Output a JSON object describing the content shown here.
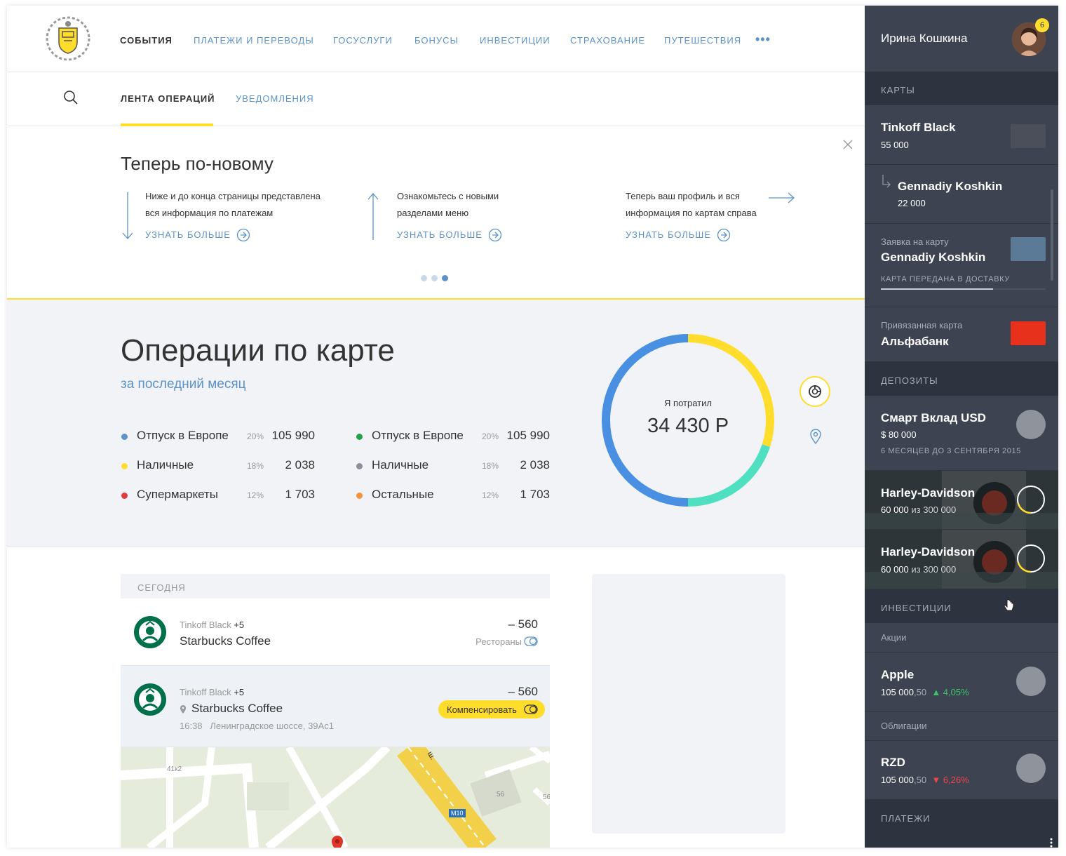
{
  "nav": {
    "items": [
      "События",
      "Платежи и переводы",
      "Госуслуги",
      "Бонусы",
      "Инвестиции",
      "Страхование",
      "Путешествия"
    ],
    "more": "•••"
  },
  "subnav": {
    "tab_feed": "Лента операций",
    "tab_notifications": "Уведомления"
  },
  "promo": {
    "title": "Теперь по-новому",
    "tips": [
      {
        "line1": "Ниже и до конца страницы представлена",
        "line2": "вся информация по платежам",
        "link": "Узнать больше"
      },
      {
        "line1": "Ознакомьтесь  с новыми",
        "line2": "разделами меню",
        "link": "Узнать больше"
      },
      {
        "line1": "Теперь ваш профиль и вся",
        "line2": "информация по картам справа",
        "link": "Узнать больше"
      }
    ],
    "active_slide": 3
  },
  "ops": {
    "title": "Операции по карте",
    "subtitle": "за последний месяц",
    "legend_left": [
      {
        "name": "Отпуск в Европе",
        "pct": "20%",
        "value": "105 990",
        "color": "#5b93c7"
      },
      {
        "name": "Наличные",
        "pct": "18%",
        "value": "2 038",
        "color": "#ffdd2d"
      },
      {
        "name": "Супермаркеты",
        "pct": "12%",
        "value": "1 703",
        "color": "#e03c3c"
      }
    ],
    "legend_right": [
      {
        "name": "Отпуск в Европе",
        "pct": "20%",
        "value": "105 990",
        "color": "#22a14d"
      },
      {
        "name": "Наличные",
        "pct": "18%",
        "value": "2 038",
        "color": "#8a8f99"
      },
      {
        "name": "Остальные",
        "pct": "12%",
        "value": "1 703",
        "color": "#f5943a"
      }
    ],
    "donut_caption": "Я потратил",
    "donut_value": "34 430 Р"
  },
  "chart_data": {
    "type": "pie",
    "title": "",
    "segments": [
      {
        "color": "#ffdd2d",
        "fraction": 0.3
      },
      {
        "color": "#4fe0c2",
        "fraction": 0.2
      },
      {
        "color": "#4a90e2",
        "fraction": 0.5
      }
    ]
  },
  "feed": {
    "day": "Сегодня",
    "rows": [
      {
        "card": "Tinkoff Black",
        "bonus": "+5",
        "shop": "Starbucks Coffee",
        "amount": "– 560",
        "category": "Рестораны"
      },
      {
        "card": "Tinkoff Black",
        "bonus": "+5",
        "shop": "Starbucks Coffee",
        "amount": "– 560",
        "compensate": "Компенсировать",
        "time": "16:38",
        "address": "Ленинградское шоссе, 39Ас1"
      }
    ],
    "map_labels": [
      "41к2",
      "56",
      "56",
      "ш.",
      "М10"
    ]
  },
  "side": {
    "user_name": "Ирина Кошкина",
    "badge": "6",
    "sections": {
      "cards": "Карты",
      "deposits": "Депозиты",
      "investments": "Инвестиции",
      "payments": "Платежи"
    },
    "cards": [
      {
        "title": "Tinkoff Black",
        "sub": "55 000",
        "chip": "#4a4f5a"
      },
      {
        "title": "Gennadiy Koshkin",
        "sub": "22 000"
      },
      {
        "label": "Заявка на карту",
        "title": "Gennadiy Koshkin",
        "status": "Карта передана в доставку",
        "chip": "#5a7a95",
        "progress": 0.68
      },
      {
        "label": "Привязанная карта",
        "title": "Альфабанк",
        "chip": "#e8311c"
      }
    ],
    "deposits": [
      {
        "title": "Смарт Вклад USD",
        "sub": "$ 80 000",
        "note": "6 месяцев до 3 сентября 2015"
      },
      {
        "title": "Harley-Davidson",
        "sub": "60 000",
        "of": "из 300 000",
        "progress": 0.2
      },
      {
        "title": "Harley-Davidson",
        "sub": "60 000",
        "of": "из 300 000",
        "progress": 0.2
      }
    ],
    "invest": {
      "stocks_label": "Акции",
      "bonds_label": "Облигации",
      "apple": {
        "title": "Apple",
        "value": "105 000",
        "dec": ",50",
        "change": "▲ 4,05%"
      },
      "rzd": {
        "title": "RZD",
        "value": "105 000",
        "dec": ",50",
        "change": "▼ 6,26%"
      }
    }
  }
}
